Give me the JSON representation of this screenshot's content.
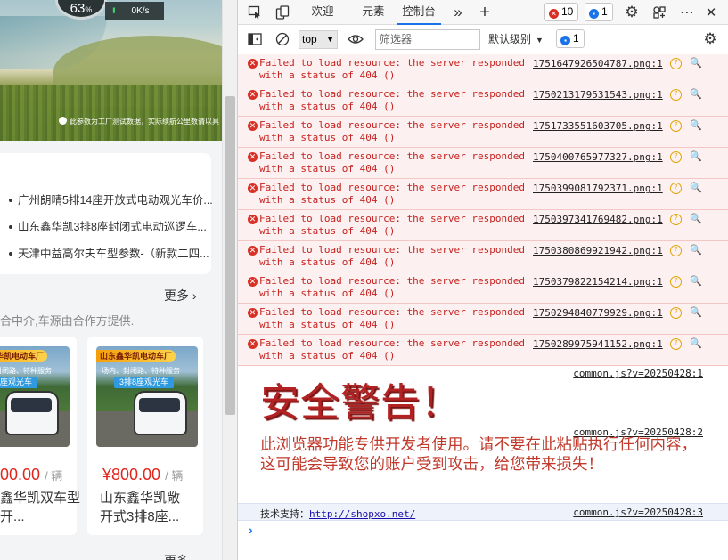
{
  "left_page": {
    "hero": {
      "speed_pct": "63",
      "speed_pct_suffix": "%",
      "speed_rate": "0K/s",
      "note": "此参数为工厂测试数据，实际续航公里数请以具"
    },
    "news": [
      "广州朗晴5排14座开放式电动观光车价...",
      "山东鑫华凯3排8座封闭式电动巡逻车...",
      "天津中益高尔夫车型参数-（新款二四..."
    ],
    "more_label": "更多",
    "disclaimer": "合中介,车源由合作方提供.",
    "cards": [
      {
        "banner": "山东鑫华凯电动车厂",
        "sub": "场内、封闭路、特种服务",
        "tag": "16座观光车",
        "price": "00.00",
        "unit": "/ 辆",
        "name": "鑫华凯双车型开..."
      },
      {
        "banner": "山东鑫华凯电动车厂",
        "sub": "场内、封闭路、特种服务",
        "tag": "3排8座观光车",
        "price": "¥800.00",
        "unit": "/ 辆",
        "name": "山东鑫华凯敞开式3排8座..."
      }
    ],
    "more2_label": "更多"
  },
  "devtools": {
    "tabs": [
      {
        "label": "欢迎",
        "active": false
      },
      {
        "label": "元素",
        "active": false
      },
      {
        "label": "控制台",
        "active": true
      }
    ],
    "icons": {
      "more_tabs": "»",
      "add_tab": "+",
      "settings": "⚙",
      "more": "⋯",
      "close": "✕"
    },
    "error_count": "10",
    "message_count": "1",
    "toolbar": {
      "context": "top",
      "filter_placeholder": "筛选器",
      "levels": "默认级别",
      "issues_count": "1"
    },
    "errors": [
      {
        "msg": "Failed to load resource: the server responded with a status of 404 ()",
        "src": "1751647926504787.png:1"
      },
      {
        "msg": "Failed to load resource: the server responded with a status of 404 ()",
        "src": "1750213179531543.png:1"
      },
      {
        "msg": "Failed to load resource: the server responded with a status of 404 ()",
        "src": "1751733551603705.png:1"
      },
      {
        "msg": "Failed to load resource: the server responded with a status of 404 ()",
        "src": "1750400765977327.png:1"
      },
      {
        "msg": "Failed to load resource: the server responded with a status of 404 ()",
        "src": "1750399081792371.png:1"
      },
      {
        "msg": "Failed to load resource: the server responded with a status of 404 ()",
        "src": "1750397341769482.png:1"
      },
      {
        "msg": "Failed to load resource: the server responded with a status of 404 ()",
        "src": "1750380869921942.png:1"
      },
      {
        "msg": "Failed to load resource: the server responded with a status of 404 ()",
        "src": "1750379822154214.png:1"
      },
      {
        "msg": "Failed to load resource: the server responded with a status of 404 ()",
        "src": "1750294840779929.png:1"
      },
      {
        "msg": "Failed to load resource: the server responded with a status of 404 ()",
        "src": "1750289975941152.png:1"
      }
    ],
    "warning_title_src": "common.js?v=20250428:1",
    "warning_title": "安全警告！",
    "warning_text_src": "common.js?v=20250428:2",
    "warning_text": "此浏览器功能专供开发者使用。请不要在此粘贴执行任何内容，这可能会导致您的账户受到攻击，给您带来损失！",
    "support_label": "技术支持：",
    "support_link": "http://shopxo.net/",
    "support_src": "common.js?v=20250428:3",
    "prompt": "›"
  }
}
